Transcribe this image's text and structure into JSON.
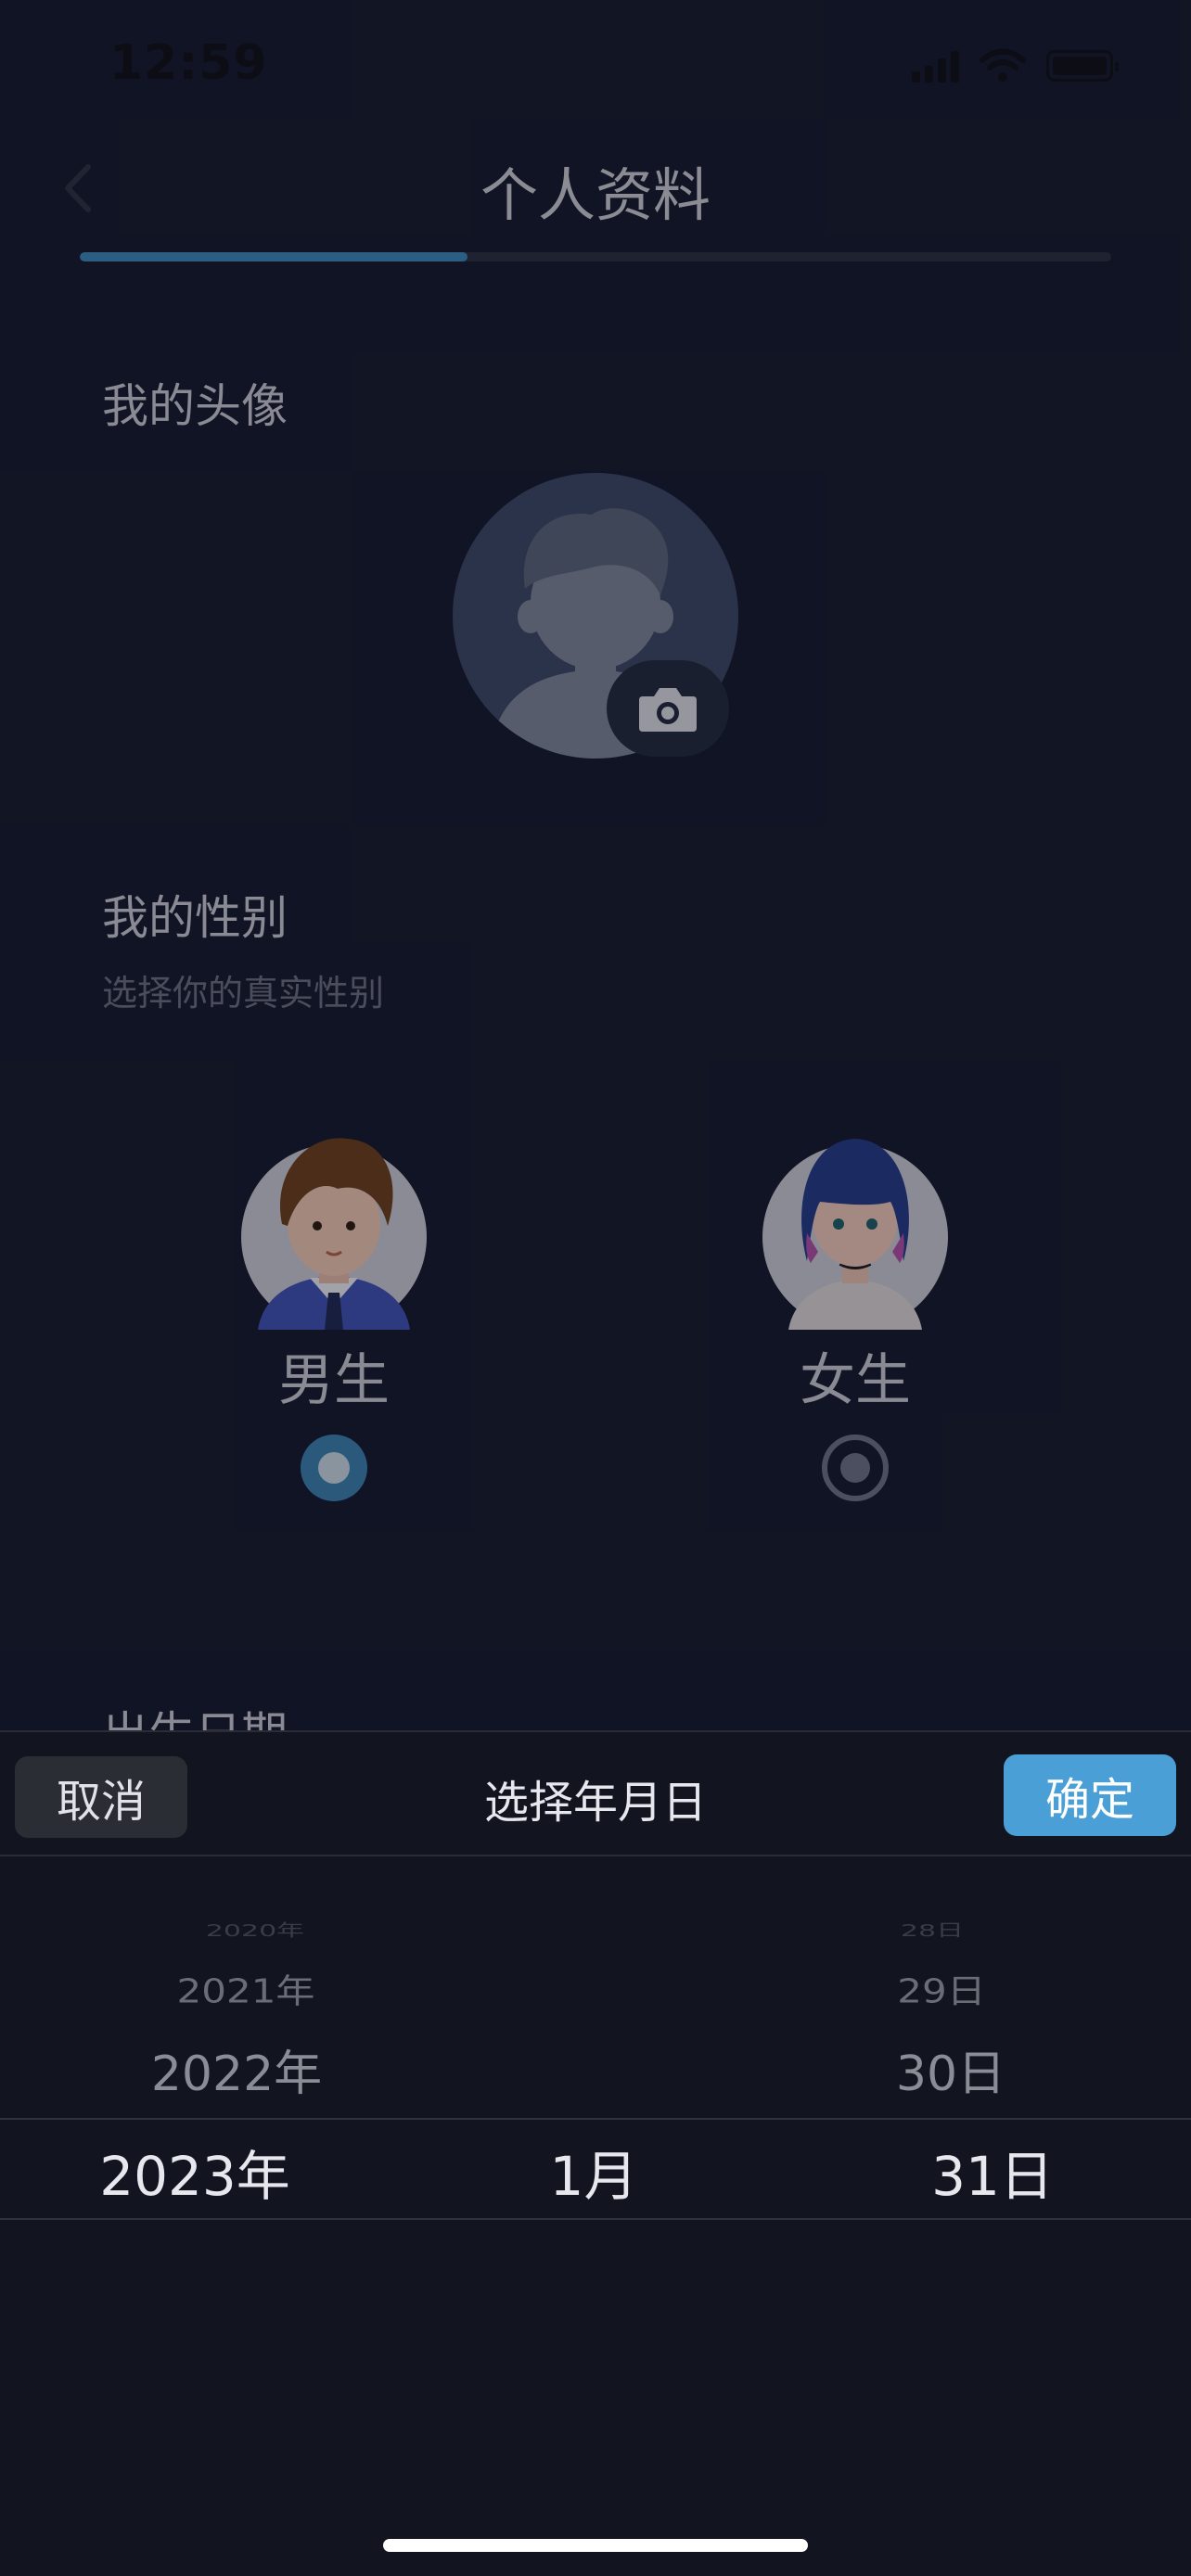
{
  "status_bar": {
    "time": "12:59"
  },
  "header": {
    "title": "个人资料",
    "progress": 0.33
  },
  "avatar_section": {
    "title": "我的头像"
  },
  "gender_section": {
    "title": "我的性别",
    "subtitle": "选择你的真实性别",
    "options": [
      {
        "label": "男生",
        "selected": true
      },
      {
        "label": "女生",
        "selected": false
      }
    ]
  },
  "birth_section": {
    "title": "出生日期"
  },
  "picker": {
    "cancel_label": "取消",
    "title": "选择年月日",
    "confirm_label": "确定",
    "years": [
      "2020年",
      "2021年",
      "2022年",
      "2023年"
    ],
    "months": [
      "1月"
    ],
    "days": [
      "28日",
      "29日",
      "30日",
      "31日"
    ],
    "selected": {
      "year": "2023年",
      "month": "1月",
      "day": "31日"
    }
  },
  "colors": {
    "accent": "#4aa0d6",
    "progress": "#3b86b9",
    "background": "#161a2e"
  }
}
